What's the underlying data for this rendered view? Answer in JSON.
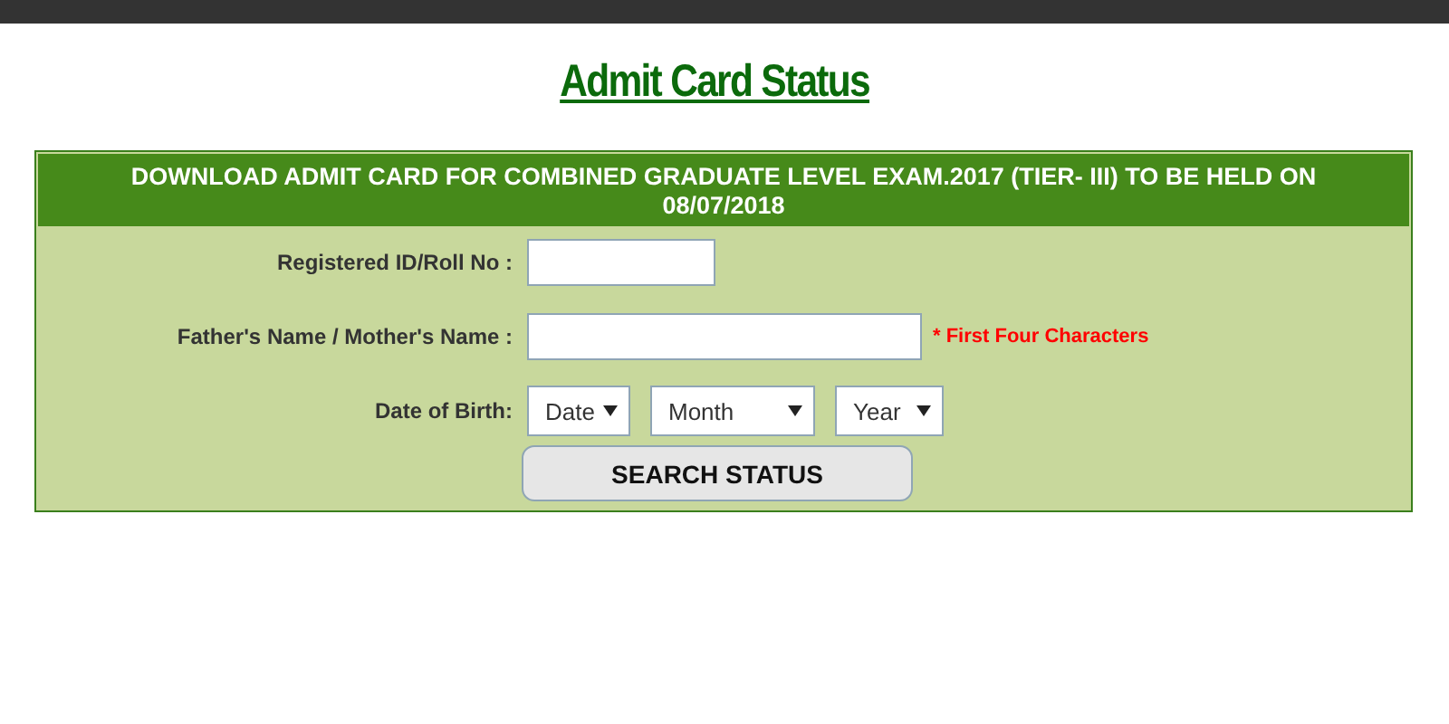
{
  "title": "Admit Card Status",
  "panel": {
    "heading": "DOWNLOAD ADMIT CARD FOR COMBINED GRADUATE LEVEL EXAM.2017 (TIER- III) TO BE HELD ON 08/07/2018",
    "fields": [
      {
        "kind": "short",
        "label": "Registered ID/Roll No :"
      },
      {
        "kind": "long",
        "label": "Father's Name / Mother's Name :",
        "hint": "* First Four Characters"
      },
      {
        "kind": "selects",
        "label": "Date of Birth:",
        "options": [
          "Date",
          "Month",
          "Year"
        ]
      }
    ],
    "button": "SEARCH STATUS"
  }
}
